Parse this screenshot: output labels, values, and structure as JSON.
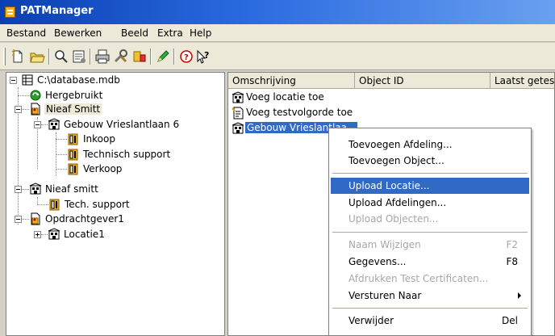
{
  "window": {
    "title": "PATManager"
  },
  "menu": [
    "Bestand",
    "Bewerken",
    "Beeld",
    "Extra",
    "Help"
  ],
  "toolbar_icons": [
    "new-icon",
    "open-icon",
    "search-icon",
    "properties-icon",
    "print-icon",
    "tools-icon",
    "device-icon",
    "pen-icon",
    "help-icon",
    "whats-this-icon"
  ],
  "tree": {
    "root": "C:\\database.mdb",
    "nodes": [
      {
        "label": "Hergebruikt"
      },
      {
        "label": "Nieaf Smitt"
      },
      {
        "label": "Gebouw Vrieslantlaan 6"
      },
      {
        "label": "Inkoop"
      },
      {
        "label": "Technisch support"
      },
      {
        "label": "Verkoop"
      },
      {
        "label": "Nieaf smitt"
      },
      {
        "label": "Tech. support"
      },
      {
        "label": "Opdrachtgever1"
      },
      {
        "label": "Locatie1"
      }
    ]
  },
  "list": {
    "columns": [
      "Omschrijving",
      "Object ID",
      "Laatst getest"
    ],
    "rows": [
      {
        "label": "Voeg locatie toe"
      },
      {
        "label": "Voeg testvolgorde toe"
      },
      {
        "label": "Gebouw Vrieslantlaa..."
      }
    ]
  },
  "context_menu": {
    "items": [
      {
        "label": "Toevoegen Afdeling...",
        "shortcut": "",
        "disabled": false
      },
      {
        "label": "Toevoegen Object...",
        "shortcut": "",
        "disabled": false
      },
      {
        "label": "Upload Locatie...",
        "shortcut": "",
        "disabled": false,
        "highlighted": true
      },
      {
        "label": "Upload Afdelingen...",
        "shortcut": "",
        "disabled": false
      },
      {
        "label": "Upload Objecten...",
        "shortcut": "",
        "disabled": true
      },
      {
        "label": "Naam Wijzigen",
        "shortcut": "F2",
        "disabled": true
      },
      {
        "label": "Gegevens...",
        "shortcut": "F8",
        "disabled": false
      },
      {
        "label": "Afdrukken Test Certificaten...",
        "shortcut": "",
        "disabled": true
      },
      {
        "label": "Versturen Naar",
        "shortcut": "",
        "disabled": false,
        "submenu": true
      },
      {
        "label": "Verwijder",
        "shortcut": "Del",
        "disabled": false
      }
    ]
  },
  "colors": {
    "titlebar": "#0a3fb3",
    "selection": "#316ac5",
    "menu_bg": "#ece9d8"
  }
}
